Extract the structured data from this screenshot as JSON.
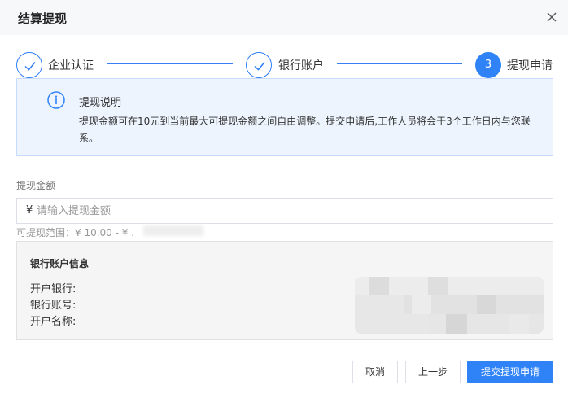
{
  "dialog": {
    "title": "结算提现"
  },
  "steps": [
    {
      "index": "1",
      "label": "企业认证",
      "status": "done"
    },
    {
      "index": "2",
      "label": "银行账户",
      "status": "done"
    },
    {
      "index": "3",
      "label": "提现申请",
      "status": "active"
    }
  ],
  "info": {
    "title": "提现说明",
    "text": "提现金额可在10元到当前最大可提现金额之间自由调整。提交申请后,工作人员将会于3个工作日内与您联系。"
  },
  "amount": {
    "label": "提现金额",
    "currency": "¥",
    "placeholder": "请输入提现金额",
    "value": "",
    "range_text": "可提现范围：¥ 10.00 - ¥ ."
  },
  "bank": {
    "title": "银行账户信息",
    "fields": [
      {
        "label": "开户银行:"
      },
      {
        "label": "银行账号:"
      },
      {
        "label": "开户名称:"
      }
    ]
  },
  "buttons": {
    "cancel": "取消",
    "prev": "上一步",
    "submit": "提交提现申请"
  },
  "colors": {
    "primary": "#2f83f7",
    "info_bg": "#edf4fe",
    "header_bg": "#f7f8fa"
  },
  "icons": {
    "close": "close-icon",
    "check": "check-icon",
    "info": "info-icon"
  }
}
